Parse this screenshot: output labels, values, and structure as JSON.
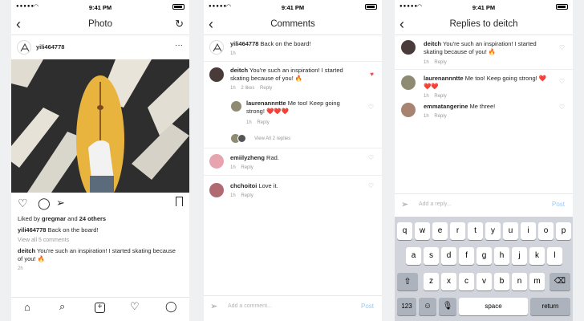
{
  "status": {
    "signal": "●●●●●",
    "time": "9:41 PM"
  },
  "photo_screen": {
    "title": "Photo",
    "username": "yili464778",
    "liked_by_prefix": "Liked by",
    "liked_by_user": "gregmar",
    "liked_by_and": "and",
    "liked_by_others": "24 others",
    "caption_user": "yili464778",
    "caption": "Back on the board!",
    "view_all": "View all 5 comments",
    "comment_user": "deitch",
    "comment_text": "You're such an inspiration! I started skating because of you! 🔥",
    "time": "2h"
  },
  "comments_screen": {
    "title": "Comments",
    "caption_user": "yili464778",
    "caption": "Back on the board!",
    "caption_time": "1h",
    "comments": [
      {
        "user": "deitch",
        "text": "You're such an inspiration! I started skating because of you! 🔥",
        "time": "1h",
        "likes": "2 likes",
        "reply": "Reply"
      },
      {
        "user": "laurenannntte",
        "text": "Me too! Keep going strong! ❤️❤️❤️",
        "time": "1h",
        "reply": "Reply"
      },
      {
        "user": "emiilyzheng",
        "text": "Rad.",
        "time": "1h",
        "reply": "Reply"
      },
      {
        "user": "chchoitoi",
        "text": "Love it.",
        "time": "1h",
        "reply": "Reply"
      }
    ],
    "view_replies": "View All 2 replies",
    "placeholder": "Add a comment...",
    "post": "Post"
  },
  "replies_screen": {
    "title": "Replies to deitch",
    "replies": [
      {
        "user": "deitch",
        "text": "You're such an inspiration! I started skating because of you! 🔥",
        "time": "1h",
        "reply": "Reply"
      },
      {
        "user": "laurenannntte",
        "text": "Me too! Keep going strong! ❤️❤️❤️",
        "time": "1h",
        "reply": "Reply"
      },
      {
        "user": "emmatangerine",
        "text": "Me three!",
        "time": "1h",
        "reply": "Reply"
      }
    ],
    "placeholder": "Add a reply...",
    "post": "Post"
  },
  "keyboard": {
    "row1": [
      "q",
      "w",
      "e",
      "r",
      "t",
      "y",
      "u",
      "i",
      "o",
      "p"
    ],
    "row2": [
      "a",
      "s",
      "d",
      "f",
      "g",
      "h",
      "j",
      "k",
      "l"
    ],
    "row3": [
      "z",
      "x",
      "c",
      "v",
      "b",
      "n",
      "m"
    ],
    "numbers": "123",
    "space": "space",
    "return": "return"
  }
}
